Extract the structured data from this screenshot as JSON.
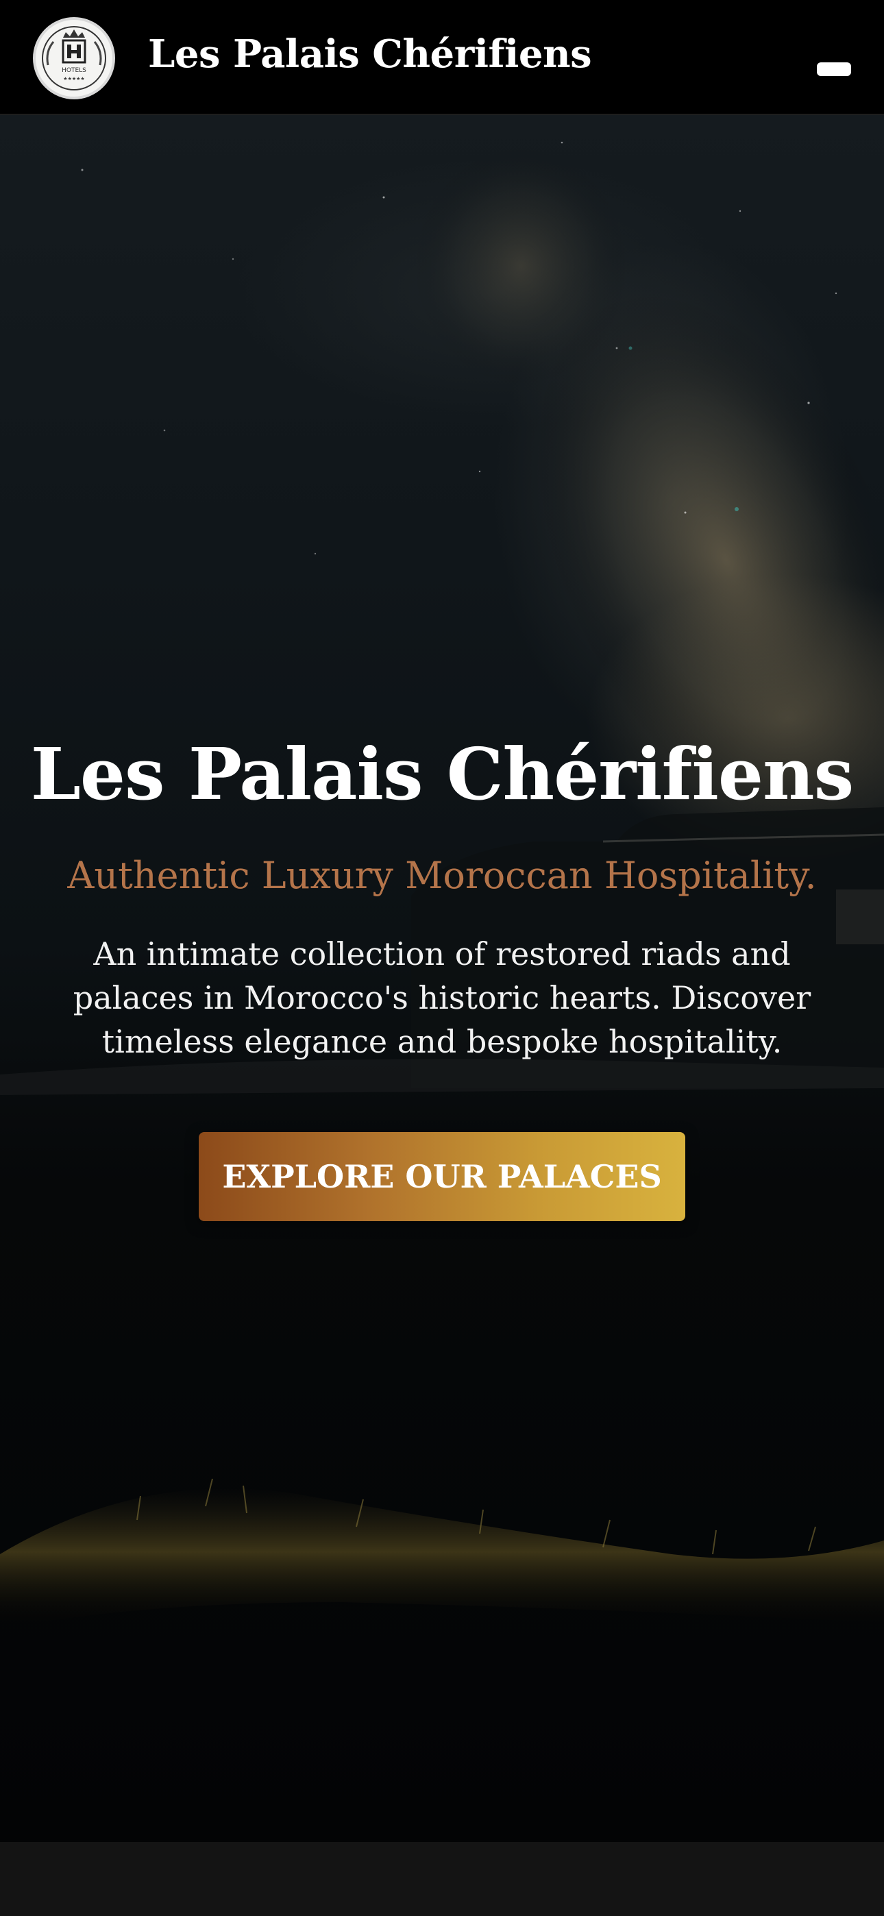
{
  "header": {
    "logo_text": "HOTELS",
    "brand": "Les Palais Chérifiens",
    "menu_icon": "hamburger-icon"
  },
  "hero": {
    "title": "Les Palais Chérifiens",
    "tagline": "Authentic Luxury Moroccan Hospitality.",
    "description": "An intimate collection of restored riads and palaces in Morocco's historic hearts. Discover timeless elegance and bespoke hospitality.",
    "cta_label": "EXPLORE OUR PALACES",
    "background": "night-sky-milky-way-desert-image"
  },
  "colors": {
    "header_bg": "#000000",
    "tagline": "#b4744a",
    "cta_start": "#8c4a1a",
    "cta_end": "#d8b23e",
    "footer_bg": "#141414"
  }
}
